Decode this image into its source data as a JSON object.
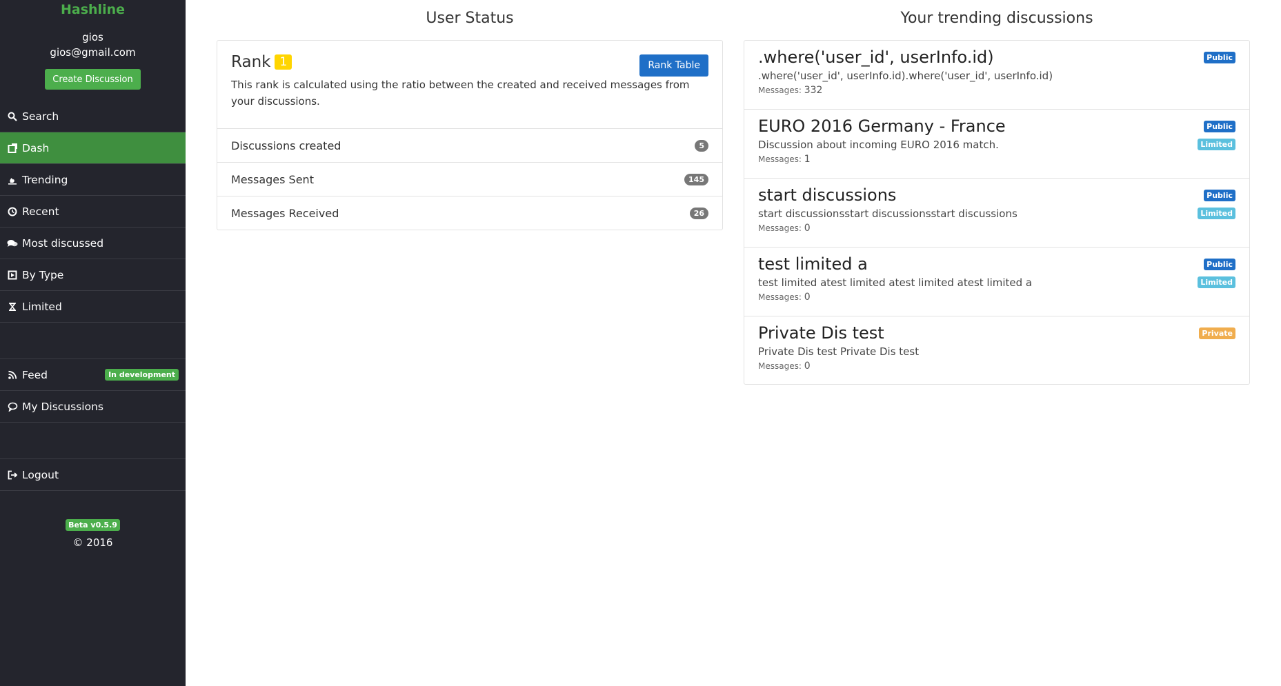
{
  "sidebar": {
    "brand": "Hashline",
    "user": {
      "name": "gios",
      "email": "gios@gmail.com"
    },
    "create_button": "Create Discussion",
    "nav": [
      {
        "label": "Search",
        "icon": "search-icon"
      },
      {
        "label": "Dash",
        "icon": "dashboard-icon",
        "active": true
      },
      {
        "label": "Trending",
        "icon": "fire-icon"
      },
      {
        "label": "Recent",
        "icon": "clock-icon"
      },
      {
        "label": "Most discussed",
        "icon": "comments-icon"
      },
      {
        "label": "By Type",
        "icon": "play-square-icon"
      },
      {
        "label": "Limited",
        "icon": "hourglass-icon"
      }
    ],
    "feed": {
      "label": "Feed",
      "badge": "In development",
      "icon": "rss-icon"
    },
    "my_discussions": {
      "label": "My Discussions",
      "icon": "comment-icon"
    },
    "logout": {
      "label": "Logout",
      "icon": "sign-out-icon"
    },
    "version": "Beta v0.5.9",
    "copyright": "© 2016"
  },
  "user_status": {
    "title": "User Status",
    "rank_label": "Rank",
    "rank_value": "1",
    "rank_table_button": "Rank Table",
    "description": "This rank is calculated using the ratio between the created and received messages from your discussions.",
    "stats": [
      {
        "label": "Discussions created",
        "value": "5"
      },
      {
        "label": "Messages Sent",
        "value": "145"
      },
      {
        "label": "Messages Received",
        "value": "26"
      }
    ]
  },
  "trending": {
    "title": "Your trending discussions",
    "messages_label": "Messages:",
    "items": [
      {
        "title": ".where('user_id', userInfo.id)",
        "description": ".where('user_id', userInfo.id).where('user_id', userInfo.id)",
        "messages": "332",
        "badges": [
          "Public"
        ]
      },
      {
        "title": "EURO 2016 Germany - France",
        "description": "Discussion about incoming EURO 2016 match.",
        "messages": "1",
        "badges": [
          "Public",
          "Limited"
        ]
      },
      {
        "title": "start discussions",
        "description": "start discussionsstart discussionsstart discussions",
        "messages": "0",
        "badges": [
          "Public",
          "Limited"
        ]
      },
      {
        "title": "test limited a",
        "description": "test limited atest limited atest limited atest limited a",
        "messages": "0",
        "badges": [
          "Public",
          "Limited"
        ]
      },
      {
        "title": "Private Dis test",
        "description": "Private Dis test Private Dis test",
        "messages": "0",
        "badges": [
          "Private"
        ]
      }
    ]
  },
  "colors": {
    "sidebar_bg": "#24252d",
    "accent_green": "#4cae4c",
    "primary_blue": "#1f6fc7",
    "limited_badge": "#5bc0de",
    "private_badge": "#f0ad4e",
    "rank_badge": "#ffd500"
  }
}
